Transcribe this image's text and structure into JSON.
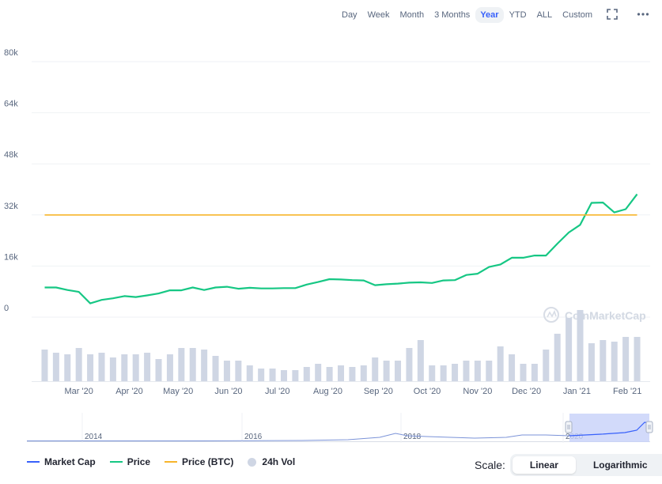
{
  "toolbar": {
    "ranges": [
      "Day",
      "Week",
      "Month",
      "3 Months",
      "Year",
      "YTD",
      "ALL",
      "Custom"
    ],
    "active_range": "Year",
    "fullscreen_icon": "fullscreen-icon",
    "more_icon": "more-horizontal-icon"
  },
  "watermark": "CoinMarketCap",
  "legend": {
    "items": [
      {
        "label": "Market Cap",
        "color": "#3861fb",
        "marker": "line"
      },
      {
        "label": "Price",
        "color": "#16c784",
        "marker": "line"
      },
      {
        "label": "Price (BTC)",
        "color": "#f7b52b",
        "marker": "line"
      },
      {
        "label": "24h Vol",
        "color": "#cfd6e4",
        "marker": "dot"
      }
    ]
  },
  "scale": {
    "label": "Scale:",
    "options": [
      "Linear",
      "Logarithmic"
    ],
    "active": "Linear"
  },
  "chart_data": {
    "type": "line",
    "y_ticks": [
      "80k",
      "64k",
      "48k",
      "32k",
      "16k",
      "0"
    ],
    "ylim": [
      0,
      80000
    ],
    "grid": true,
    "x_ticks": [
      "Mar '20",
      "Apr '20",
      "May '20",
      "Jun '20",
      "Jul '20",
      "Aug '20",
      "Sep '20",
      "Oct '20",
      "Nov '20",
      "Dec '20",
      "Jan '21",
      "Feb '21"
    ],
    "x": [
      "2020-02-09",
      "2020-02-16",
      "2020-02-23",
      "2020-03-01",
      "2020-03-08",
      "2020-03-15",
      "2020-03-22",
      "2020-03-29",
      "2020-04-05",
      "2020-04-12",
      "2020-04-19",
      "2020-04-26",
      "2020-05-03",
      "2020-05-10",
      "2020-05-17",
      "2020-05-24",
      "2020-05-31",
      "2020-06-07",
      "2020-06-14",
      "2020-06-21",
      "2020-06-28",
      "2020-07-05",
      "2020-07-12",
      "2020-07-19",
      "2020-07-26",
      "2020-08-02",
      "2020-08-09",
      "2020-08-16",
      "2020-08-23",
      "2020-08-30",
      "2020-09-06",
      "2020-09-13",
      "2020-09-20",
      "2020-09-27",
      "2020-10-04",
      "2020-10-11",
      "2020-10-18",
      "2020-10-25",
      "2020-11-01",
      "2020-11-08",
      "2020-11-15",
      "2020-11-22",
      "2020-11-29",
      "2020-12-06",
      "2020-12-13",
      "2020-12-20",
      "2020-12-27",
      "2021-01-03",
      "2021-01-10",
      "2021-01-17",
      "2021-01-24",
      "2021-01-31",
      "2021-02-07"
    ],
    "series": [
      {
        "name": "Price",
        "color": "#16c784",
        "values": [
          9300,
          9300,
          8500,
          7900,
          4300,
          5400,
          5900,
          6600,
          6300,
          6800,
          7400,
          8400,
          8400,
          9300,
          8500,
          9300,
          9500,
          8900,
          9200,
          9000,
          9000,
          9100,
          9100,
          10200,
          11000,
          11900,
          11800,
          11600,
          11500,
          10000,
          10300,
          10500,
          10800,
          10900,
          10700,
          11500,
          11600,
          13200,
          13600,
          15700,
          16500,
          18600,
          18600,
          19300,
          19300,
          23000,
          26500,
          28900,
          35800,
          35900,
          32800,
          33800,
          38500
        ]
      },
      {
        "name": "Price (BTC)",
        "color": "#f7b52b",
        "values": [
          32000,
          32000,
          32000,
          32000,
          32000,
          32000,
          32000,
          32000,
          32000,
          32000,
          32000,
          32000,
          32000,
          32000,
          32000,
          32000,
          32000,
          32000,
          32000,
          32000,
          32000,
          32000,
          32000,
          32000,
          32000,
          32000,
          32000,
          32000,
          32000,
          32000,
          32000,
          32000,
          32000,
          32000,
          32000,
          32000,
          32000,
          32000,
          32000,
          32000,
          32000,
          32000,
          32000,
          32000,
          32000,
          32000,
          32000,
          32000,
          32000,
          32000,
          32000,
          32000,
          32000
        ]
      },
      {
        "name": "24h Vol",
        "color": "#cfd6e4",
        "type": "bar",
        "values": [
          0.4,
          0.36,
          0.34,
          0.42,
          0.34,
          0.36,
          0.3,
          0.34,
          0.34,
          0.36,
          0.28,
          0.34,
          0.42,
          0.42,
          0.4,
          0.32,
          0.26,
          0.26,
          0.2,
          0.16,
          0.16,
          0.14,
          0.14,
          0.18,
          0.22,
          0.18,
          0.2,
          0.18,
          0.2,
          0.3,
          0.26,
          0.26,
          0.42,
          0.52,
          0.2,
          0.2,
          0.22,
          0.26,
          0.26,
          0.26,
          0.44,
          0.34,
          0.22,
          0.22,
          0.4,
          0.6,
          0.8,
          0.9,
          0.48,
          0.52,
          0.5,
          0.56,
          0.56
        ]
      }
    ]
  },
  "navigator": {
    "labels": [
      "2014",
      "2016",
      "2018",
      "2020"
    ]
  }
}
